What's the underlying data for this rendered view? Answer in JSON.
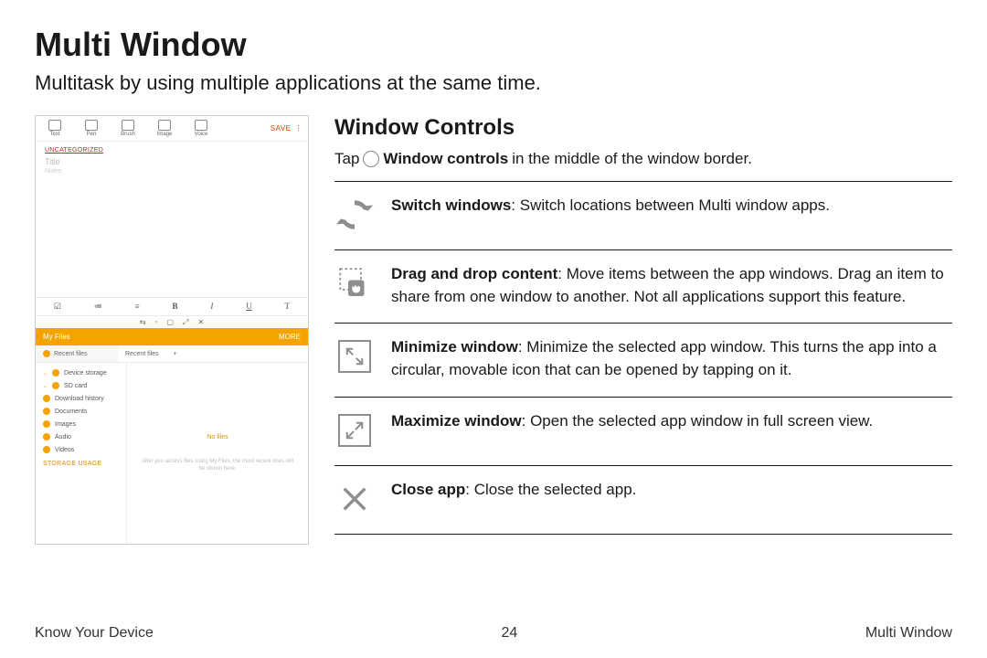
{
  "page": {
    "title": "Multi Window",
    "subtitle": "Multitask by using multiple applications at the same time."
  },
  "section": {
    "title": "Window Controls",
    "tap_prefix": "Tap",
    "tap_bold": "Window controls",
    "tap_suffix": " in the middle of the window border."
  },
  "controls": {
    "switch": {
      "label": "Switch windows",
      "desc": ": Switch locations between Multi window apps."
    },
    "drag": {
      "label": "Drag and drop content",
      "desc": ": Move items between the app windows. Drag an item to share from one window to another. Not all applications support this feature."
    },
    "min": {
      "label": "Minimize window",
      "desc": ": Minimize the selected app window. This turns the app into a circular, movable icon that can be opened by tapping on it."
    },
    "max": {
      "label": "Maximize window",
      "desc": ": Open the selected app window in full screen view."
    },
    "close": {
      "label": "Close app",
      "desc": ": Close the selected app."
    }
  },
  "footer": {
    "left": "Know Your Device",
    "page": "24",
    "right": "Multi Window"
  },
  "shot": {
    "note_tools": {
      "text": "Text",
      "pen": "Pen",
      "brush": "Brush",
      "image": "Image",
      "voice": "Voice"
    },
    "save": "SAVE",
    "uncategorized": "UNCATEGORIZED",
    "title_ph": "Title",
    "notes_ph": "Notes",
    "myfiles": "My Files",
    "more": "MORE",
    "recent": "Recent files",
    "plus": "+",
    "side": {
      "device": "Device storage",
      "sd": "SD card",
      "dl": "Download history",
      "docs": "Documents",
      "images": "Images",
      "audio": "Audio",
      "videos": "Videos"
    },
    "nofiles": "No files",
    "hint": "After you access files using My Files, the most recent ones will be shown here.",
    "storage": "STORAGE USAGE",
    "fmt": {
      "check": "☑",
      "list1": "≔",
      "list2": "≡",
      "b": "B",
      "i": "I",
      "u": "U",
      "t": "T"
    }
  }
}
